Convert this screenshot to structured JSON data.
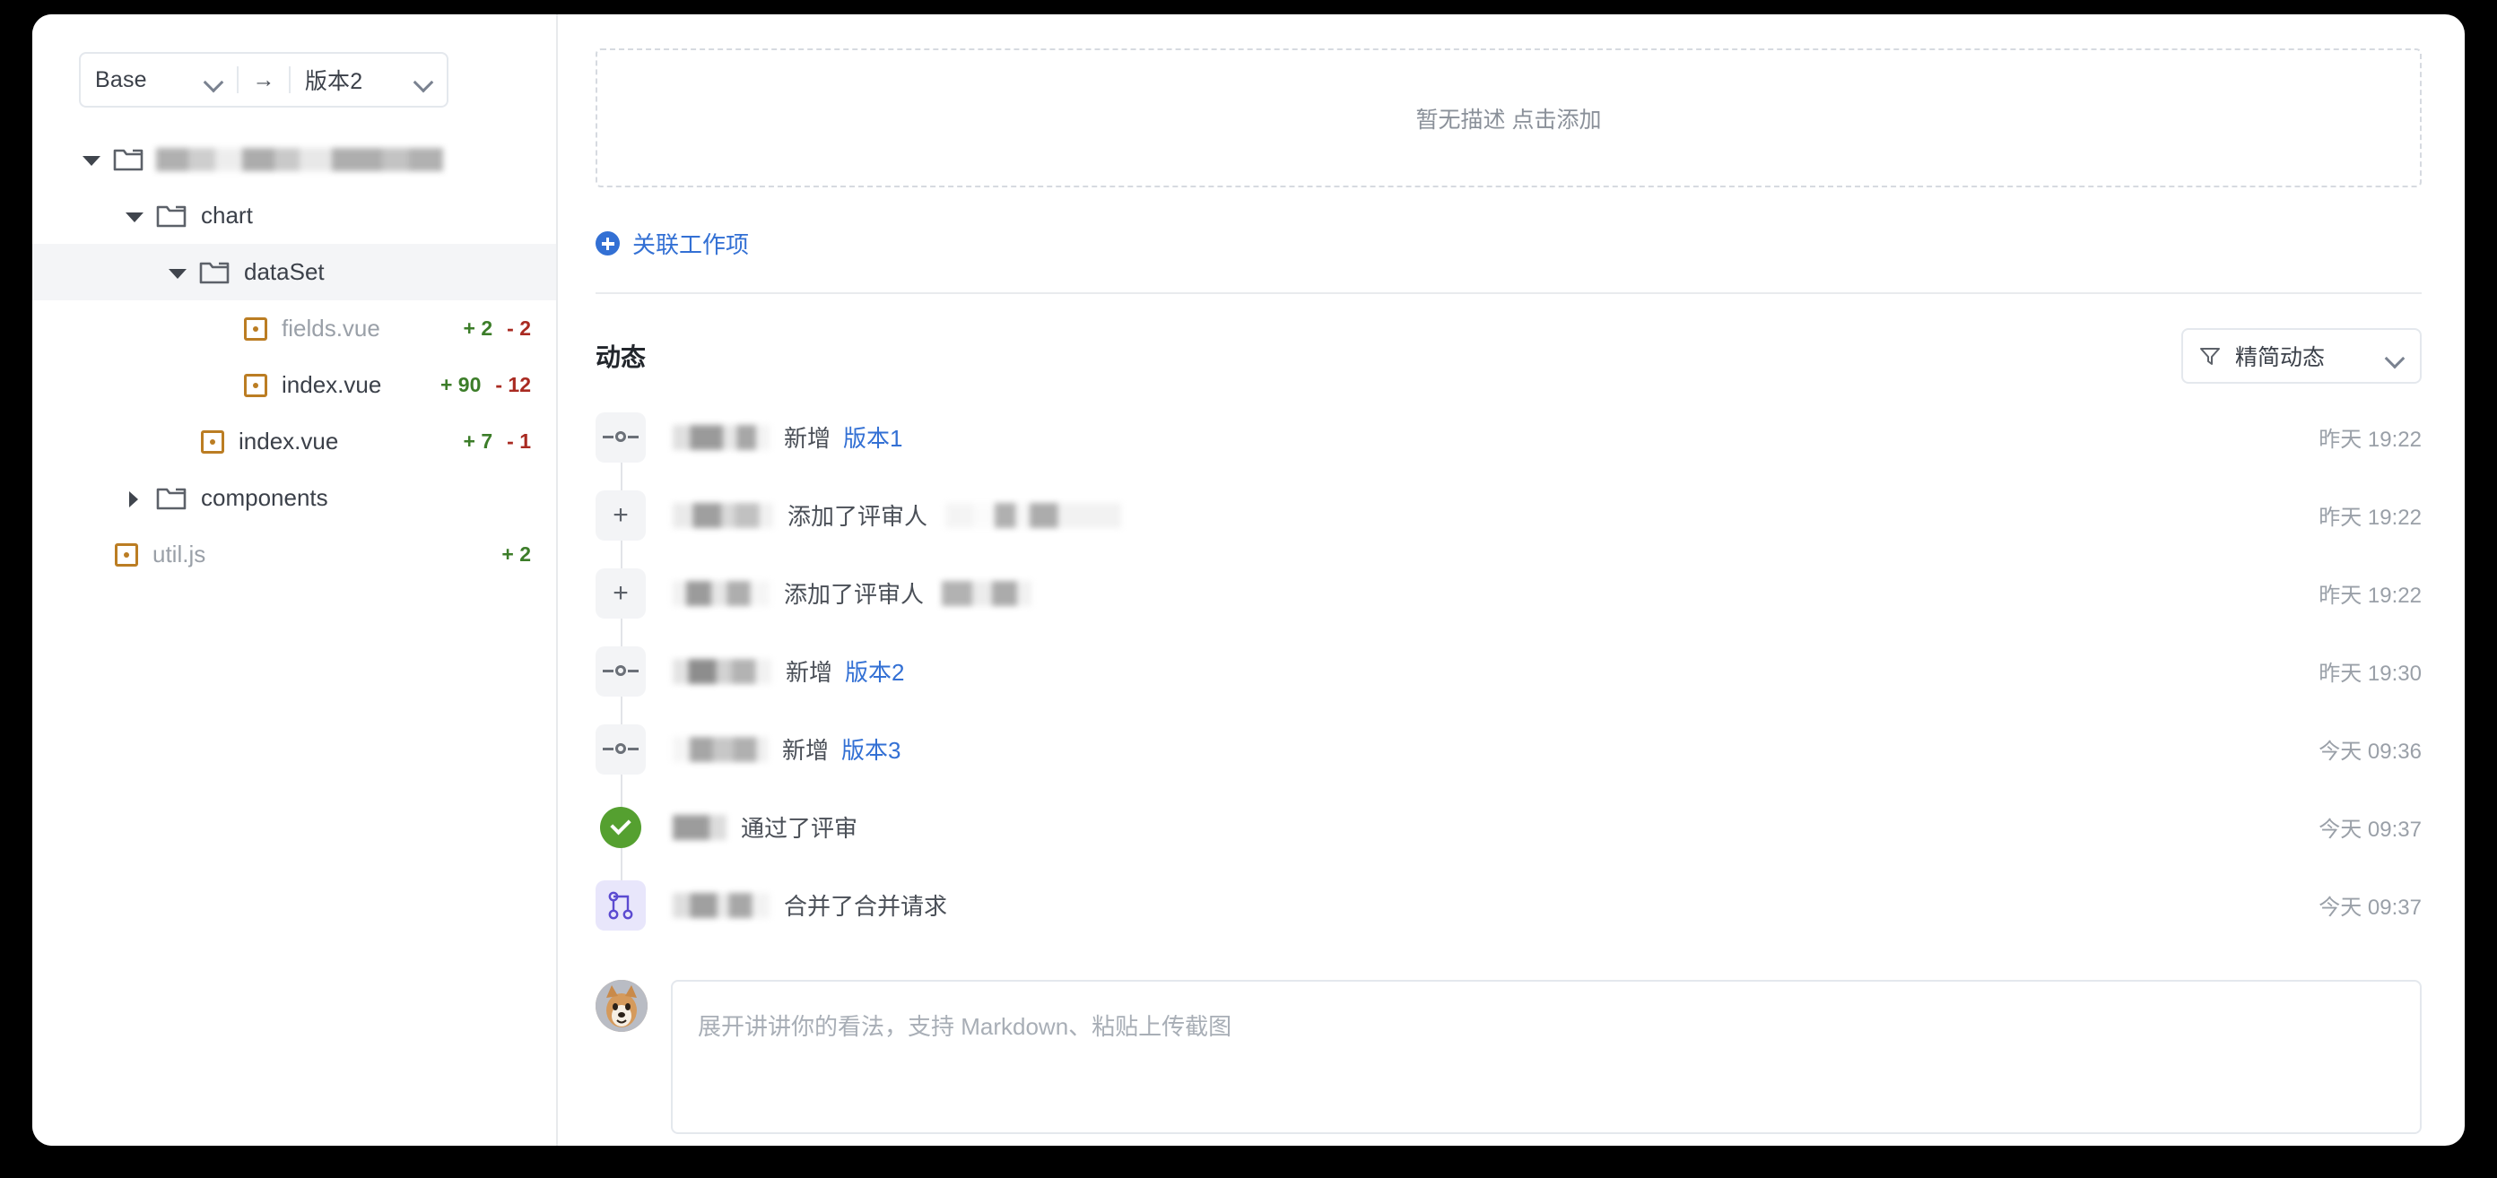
{
  "branch_selector": {
    "base_label": "Base",
    "arrow": "→",
    "target_label": "版本2",
    "base_chevron_icon": "chevron-down-icon",
    "target_chevron_icon": "chevron-down-icon"
  },
  "tree": {
    "items": [
      {
        "depth": 0,
        "kind": "folder",
        "caret": "down",
        "label": "",
        "redacted": true,
        "adds": "",
        "dels": ""
      },
      {
        "depth": 1,
        "kind": "folder",
        "caret": "down",
        "label": "chart",
        "redacted": false,
        "adds": "",
        "dels": ""
      },
      {
        "depth": 2,
        "kind": "folder",
        "caret": "down",
        "label": "dataSet",
        "redacted": false,
        "adds": "",
        "dels": "",
        "selected": true
      },
      {
        "depth": 3,
        "kind": "file",
        "caret": "none",
        "label": "fields.vue",
        "redacted": false,
        "adds": "+ 2",
        "dels": "- 2",
        "dim": true
      },
      {
        "depth": 3,
        "kind": "file",
        "caret": "none",
        "label": "index.vue",
        "redacted": false,
        "adds": "+ 90",
        "dels": "- 12"
      },
      {
        "depth": 2,
        "kind": "file",
        "caret": "none",
        "label": "index.vue",
        "redacted": false,
        "adds": "+ 7",
        "dels": "- 1"
      },
      {
        "depth": 1,
        "kind": "folder",
        "caret": "right",
        "label": "components",
        "redacted": false,
        "adds": "",
        "dels": ""
      },
      {
        "depth": 0,
        "kind": "file",
        "caret": "none",
        "label": "util.js",
        "redacted": false,
        "adds": "+ 2",
        "dels": "",
        "dim": true
      }
    ]
  },
  "description": {
    "empty_text": "暂无描述 点击添加"
  },
  "link_work_item": {
    "label": "关联工作项",
    "icon": "plus-circle-icon"
  },
  "activity": {
    "title": "动态",
    "filter": {
      "label": "精简动态",
      "filter_icon": "filter-icon",
      "chevron_icon": "chevron-down-icon"
    },
    "rows": [
      {
        "icon": "commit-icon",
        "action": "新增",
        "link": "版本1",
        "time": "昨天 19:22",
        "user_class": "u1",
        "tail_class": ""
      },
      {
        "icon": "plus-icon",
        "action": "添加了评审人",
        "link": "",
        "time": "昨天 19:22",
        "user_class": "u2",
        "tail_class": "t1"
      },
      {
        "icon": "plus-icon",
        "action": "添加了评审人",
        "link": "",
        "time": "昨天 19:22",
        "user_class": "u3",
        "tail_class": "t2"
      },
      {
        "icon": "commit-icon",
        "action": "新增",
        "link": "版本2",
        "time": "昨天 19:30",
        "user_class": "u4",
        "tail_class": ""
      },
      {
        "icon": "commit-icon",
        "action": "新增",
        "link": "版本3",
        "time": "今天 09:36",
        "user_class": "u5",
        "tail_class": ""
      },
      {
        "icon": "approve-icon",
        "action": "通过了评审",
        "link": "",
        "time": "今天 09:37",
        "user_class": "u6",
        "tail_class": ""
      },
      {
        "icon": "merge-icon",
        "action": "合并了合并请求",
        "link": "",
        "time": "今天 09:37",
        "user_class": "u7",
        "tail_class": ""
      }
    ]
  },
  "comment": {
    "placeholder": "展开讲讲你的看法，支持 Markdown、粘贴上传截图",
    "avatar_name": "user-avatar"
  },
  "colors": {
    "accent_blue": "#3370d4",
    "add_green": "#3c7d29",
    "del_red": "#a92a21",
    "approve_green": "#55a030",
    "merge_purple": "#5b4ad1",
    "file_icon_orange": "#bb7d23"
  }
}
